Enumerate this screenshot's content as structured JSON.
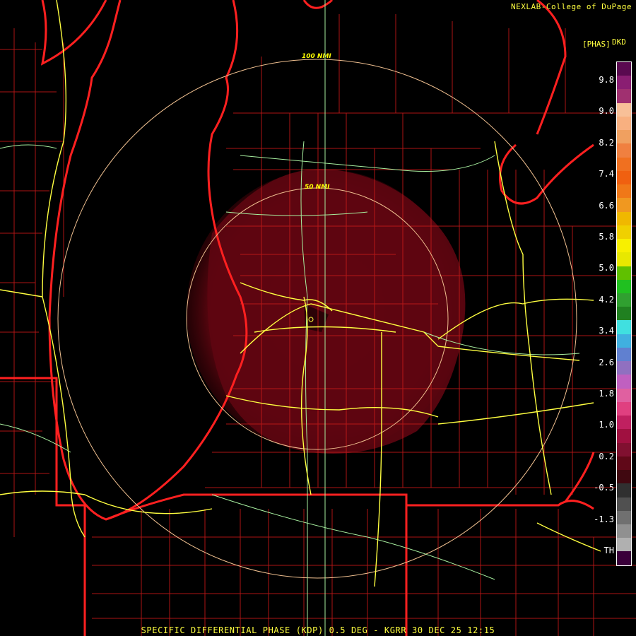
{
  "header": {
    "credit": "NEXLAB-College of DuPage"
  },
  "legend": {
    "unit": "[PHAS]",
    "title": "DKD",
    "ticks": [
      "9.8",
      "9.0",
      "8.2",
      "7.4",
      "6.6",
      "5.8",
      "5.0",
      "4.2",
      "3.4",
      "2.6",
      "1.8",
      "1.0",
      "0.2",
      "-0.5",
      "-1.3",
      "TH"
    ],
    "colors": [
      "#5a0a50",
      "#8a1e72",
      "#a03070",
      "#f8c098",
      "#f8b080",
      "#f0a060",
      "#f08040",
      "#f07020",
      "#f06010",
      "#f07818",
      "#f09820",
      "#f0b800",
      "#f0d000",
      "#f8f000",
      "#e8e800",
      "#60c000",
      "#20c020",
      "#30a030",
      "#208020",
      "#40e0e0",
      "#40b0e0",
      "#6080d0",
      "#9070c0",
      "#c060c0",
      "#e060a0",
      "#e04080",
      "#c02060",
      "#a01040",
      "#801030",
      "#600818",
      "#400810",
      "#303030",
      "#505050",
      "#707070",
      "#909090",
      "#b0b0b0",
      "#3a003a"
    ]
  },
  "map": {
    "radar_site": "KGRR",
    "range_rings": [
      {
        "label": "100 NMI"
      },
      {
        "label": "50 NMI"
      }
    ],
    "colors": {
      "state_border": "#ff2020",
      "county_border": "#c01818",
      "interstate": "#ffff40",
      "highway": "#a8f0a0",
      "ring": "#f0c090",
      "echo": "#600812"
    }
  },
  "footer": {
    "text": "SPECIFIC DIFFERENTIAL PHASE (KDP) 0.5 DEG - KGRR 30 DEC 25 12:15"
  }
}
